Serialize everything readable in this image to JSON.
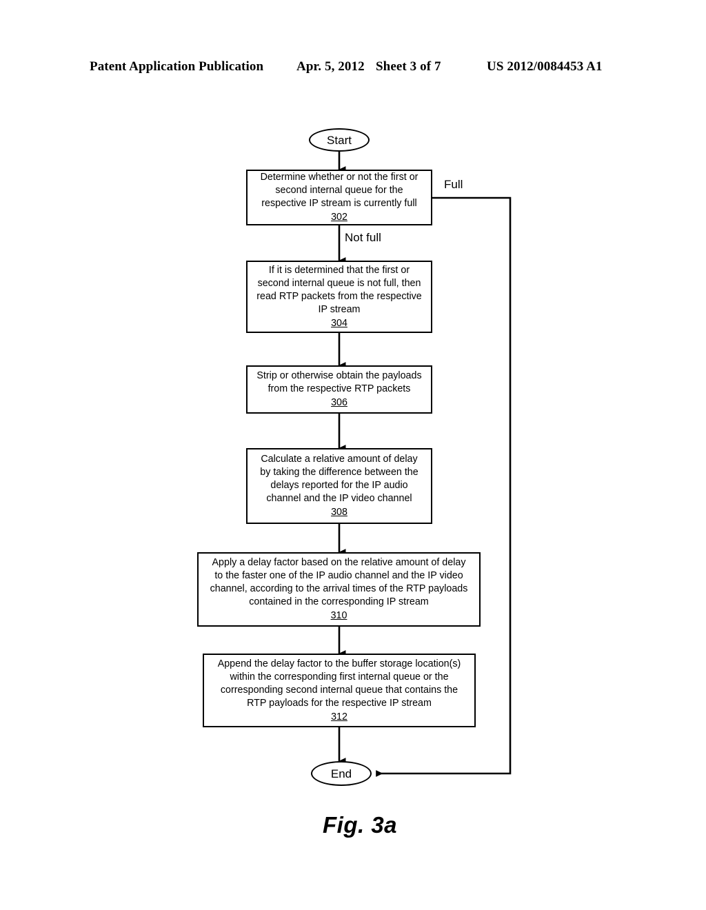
{
  "header": {
    "publication": "Patent Application Publication",
    "date": "Apr. 5, 2012",
    "sheet": "Sheet 3 of 7",
    "doc_number": "US 2012/0084453 A1"
  },
  "figure": {
    "caption": "Fig. 3a"
  },
  "flowchart": {
    "start": {
      "label": "Start"
    },
    "end": {
      "label": "End"
    },
    "edge_labels": {
      "full": "Full",
      "not_full": "Not full"
    },
    "steps": [
      {
        "ref": "302",
        "text": "Determine whether or not the first or\nsecond internal queue for the\nrespective IP stream is currently full"
      },
      {
        "ref": "304",
        "text": "If it is determined that the first or\nsecond internal queue is not full, then\nread RTP packets from the respective\nIP stream"
      },
      {
        "ref": "306",
        "text": "Strip or otherwise obtain the payloads\nfrom the respective RTP packets"
      },
      {
        "ref": "308",
        "text": "Calculate a relative amount of delay\nby taking the difference between the\ndelays reported for the IP audio\nchannel and the IP video channel"
      },
      {
        "ref": "310",
        "text": "Apply a delay factor based on the relative amount of delay\nto the faster one of the IP audio channel and the IP video\nchannel, according to the arrival times of the RTP payloads\ncontained in the corresponding IP stream"
      },
      {
        "ref": "312",
        "text": "Append the delay factor to the buffer storage location(s)\nwithin the corresponding first internal queue or the\ncorresponding second internal queue that contains the\nRTP payloads for the respective IP stream"
      }
    ]
  },
  "colors": {
    "ink": "#000000",
    "paper": "#ffffff"
  }
}
